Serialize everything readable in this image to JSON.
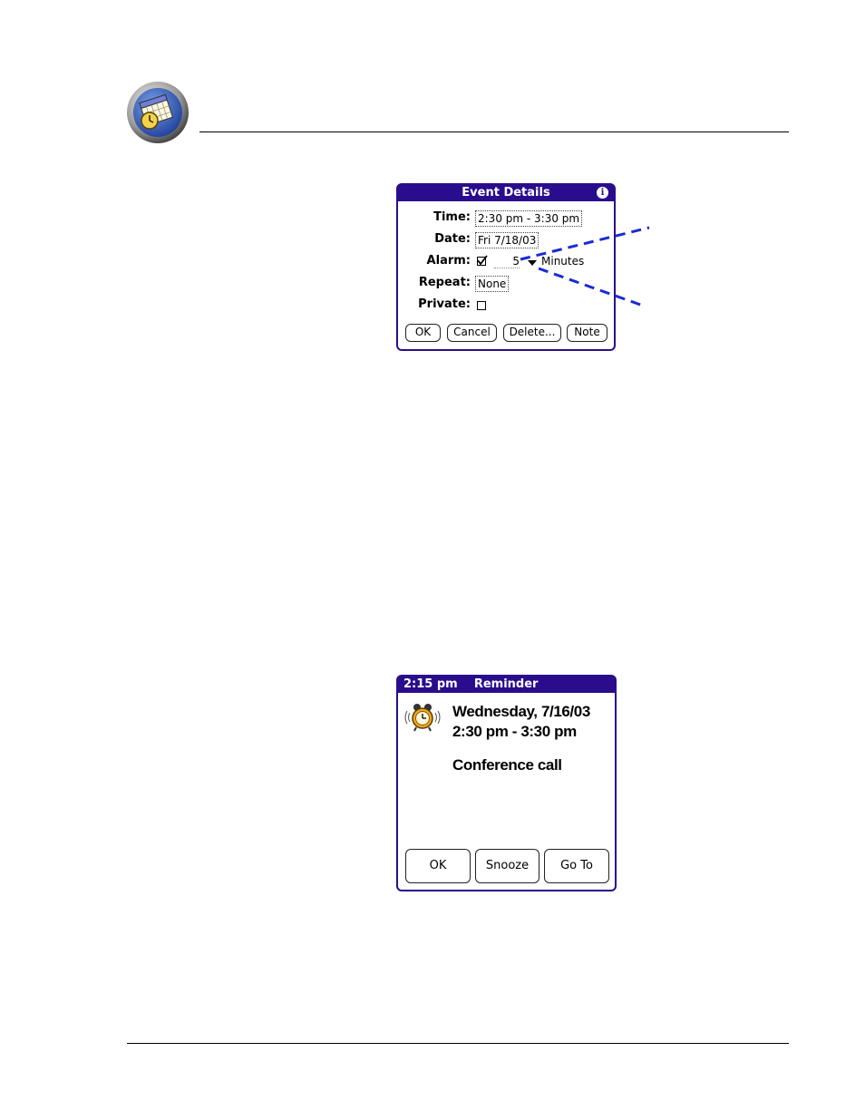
{
  "event_details": {
    "title": "Event Details",
    "info_glyph": "i",
    "time_label": "Time:",
    "time_value": "2:30 pm - 3:30 pm",
    "date_label": "Date:",
    "date_value": "Fri 7/18/03",
    "alarm_label": "Alarm:",
    "alarm_checked": true,
    "alarm_amount": "5",
    "alarm_unit": "Minutes",
    "repeat_label": "Repeat:",
    "repeat_value": "None",
    "private_label": "Private:",
    "private_checked": false,
    "buttons": {
      "ok": "OK",
      "cancel": "Cancel",
      "delete": "Delete...",
      "note": "Note"
    }
  },
  "reminder": {
    "time": "2:15 pm",
    "title": "Reminder",
    "date_line": "Wednesday, 7/16/03",
    "time_line": "2:30 pm - 3:30 pm",
    "description": "Conference call",
    "buttons": {
      "ok": "OK",
      "snooze": "Snooze",
      "goto": "Go To"
    }
  },
  "icons": {
    "app_icon": "calendar-clock-icon",
    "alarm_clock": "alarm-clock-icon"
  },
  "colors": {
    "palm_title": "#2a0d8c",
    "callout_line": "#1a2bd6",
    "alarm_clock": "#f2a81d"
  }
}
